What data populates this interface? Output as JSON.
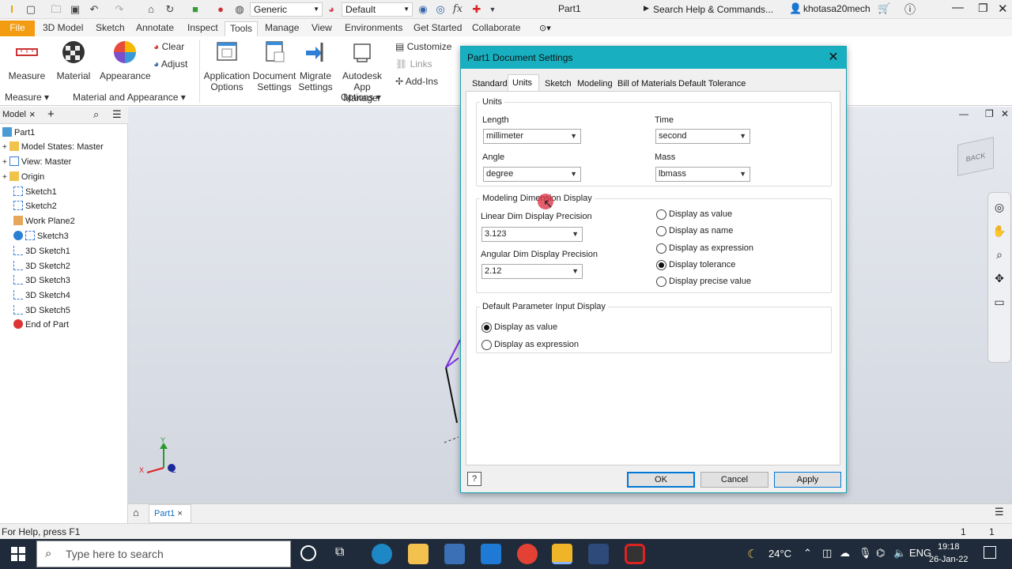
{
  "titlebar": {
    "title": "Part1",
    "appearance_select": "Generic",
    "style_select": "Default",
    "search_placeholder": "Search Help & Commands...",
    "user": "khotasa20mech",
    "fx": "fx"
  },
  "menu": {
    "tabs": [
      "File",
      "3D Model",
      "Sketch",
      "Annotate",
      "Inspect",
      "Tools",
      "Manage",
      "View",
      "Environments",
      "Get Started",
      "Collaborate"
    ]
  },
  "ribbon": {
    "measure": "Measure",
    "material": "Material",
    "appearance": "Appearance",
    "clear": "Clear",
    "adjust": "Adjust",
    "app_options_1": "Application",
    "app_options_2": "Options",
    "doc_settings_1": "Document",
    "doc_settings_2": "Settings",
    "migrate_1": "Migrate",
    "migrate_2": "Settings",
    "autodesk_1": "Autodesk",
    "autodesk_2": "App Manager",
    "customize": "Customize",
    "links": "Links",
    "addins": "Add-Ins",
    "group_measure": "Measure",
    "group_material": "Material and Appearance",
    "group_options": "Options"
  },
  "browser": {
    "tab": "Model",
    "items": [
      "Part1",
      "Model States: Master",
      "View: Master",
      "Origin",
      "Sketch1",
      "Sketch2",
      "Work Plane2",
      "Sketch3",
      "3D Sketch1",
      "3D Sketch2",
      "3D Sketch3",
      "3D Sketch4",
      "3D Sketch5",
      "End of Part"
    ]
  },
  "viewcube": {
    "back": "BACK"
  },
  "axes": {
    "x": "X",
    "y": "Y",
    "z": "Z"
  },
  "doc_tab": "Part1",
  "status": {
    "help": "For Help, press F1",
    "count1": "1",
    "count2": "1"
  },
  "taskbar": {
    "search": "Type here to search",
    "temp": "24°C",
    "time": "19:18",
    "date": "26-Jan-22"
  },
  "dialog": {
    "title": "Part1 Document Settings",
    "tabs": [
      "Standard",
      "Units",
      "Sketch",
      "Modeling",
      "Bill of Materials",
      "Default Tolerance"
    ],
    "active_tab": "Units",
    "units_group": "Units",
    "length_label": "Length",
    "length_value": "millimeter",
    "time_label": "Time",
    "time_value": "second",
    "angle_label": "Angle",
    "angle_value": "degree",
    "mass_label": "Mass",
    "mass_value": "lbmass",
    "mdd_group": "Modeling Dimension Display",
    "linear_label": "Linear Dim Display Precision",
    "linear_value": "3.123",
    "angular_label": "Angular Dim Display Precision",
    "angular_value": "2.12",
    "display_options": [
      "Display as value",
      "Display as name",
      "Display as expression",
      "Display tolerance",
      "Display precise value"
    ],
    "display_selected": 3,
    "param_group": "Default Parameter Input Display",
    "param_options": [
      "Display as value",
      "Display as expression"
    ],
    "param_selected": 0,
    "ok": "OK",
    "cancel": "Cancel",
    "apply": "Apply"
  }
}
